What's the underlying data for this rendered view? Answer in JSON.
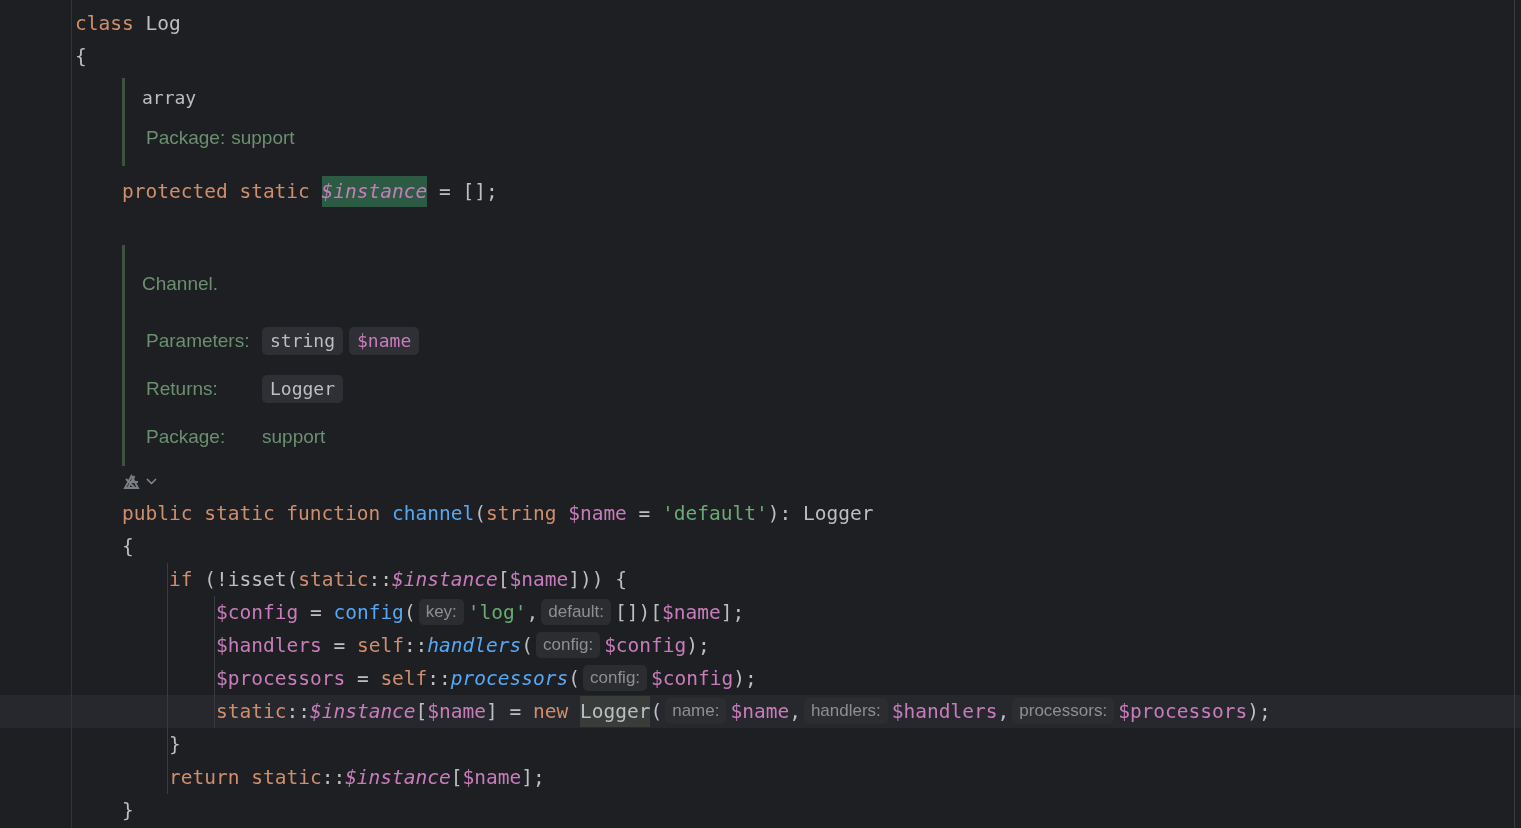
{
  "lines": [
    {
      "kind": "code",
      "current": false,
      "tokens": [
        {
          "text": "class ",
          "kind": "keyword"
        },
        {
          "text": "Log",
          "kind": "ident"
        }
      ]
    },
    {
      "kind": "code",
      "current": false,
      "tokens": [
        {
          "text": "{",
          "kind": "ident"
        }
      ],
      "children": [
        {
          "kind": "typedoc",
          "signature": "array",
          "fields": [
            {
              "label": "Package:",
              "values": [
                {
                  "text": "support",
                  "kind": "plain"
                }
              ]
            }
          ]
        },
        {
          "kind": "code",
          "current": false,
          "tokens": [
            {
              "text": "protected static ",
              "kind": "keyword"
            },
            {
              "text": "$instance",
              "kind": "static-field",
              "highlighted": true
            },
            {
              "text": " = [];",
              "kind": "ident"
            }
          ]
        },
        {
          "kind": "blank"
        },
        {
          "kind": "doc",
          "summary": "Channel.",
          "fields": [
            {
              "label": "Parameters:",
              "values": [
                {
                  "text": "string",
                  "kind": "type"
                },
                {
                  "text": "$name",
                  "kind": "var"
                }
              ]
            },
            {
              "label": "Returns:",
              "values": [
                {
                  "text": "Logger",
                  "kind": "type"
                }
              ]
            },
            {
              "label": "Package:",
              "values": [
                {
                  "text": "support",
                  "kind": "plain"
                }
              ]
            }
          ]
        },
        {
          "kind": "inlay-icons"
        },
        {
          "kind": "code",
          "current": false,
          "tokens": [
            {
              "text": "public static function ",
              "kind": "keyword"
            },
            {
              "text": "channel",
              "kind": "func"
            },
            {
              "text": "(",
              "kind": "ident"
            },
            {
              "text": "string ",
              "kind": "keyword"
            },
            {
              "text": "$name",
              "kind": "var"
            },
            {
              "text": " = ",
              "kind": "ident"
            },
            {
              "text": "'default'",
              "kind": "string"
            },
            {
              "text": "): Logger",
              "kind": "ident"
            }
          ]
        },
        {
          "kind": "code",
          "current": false,
          "tokens": [
            {
              "text": "{",
              "kind": "ident"
            }
          ],
          "children": [
            {
              "kind": "code",
              "current": false,
              "tokens": [
                {
                  "text": "if ",
                  "kind": "keyword"
                },
                {
                  "text": "(!isset(",
                  "kind": "ident"
                },
                {
                  "text": "static",
                  "kind": "keyword"
                },
                {
                  "text": "::",
                  "kind": "ident"
                },
                {
                  "text": "$instance",
                  "kind": "static-field"
                },
                {
                  "text": "[",
                  "kind": "ident"
                },
                {
                  "text": "$name",
                  "kind": "var"
                },
                {
                  "text": "])) {",
                  "kind": "ident"
                }
              ],
              "children": [
                {
                  "kind": "code",
                  "current": false,
                  "tokens": [
                    {
                      "text": "$config",
                      "kind": "var"
                    },
                    {
                      "text": " = ",
                      "kind": "ident"
                    },
                    {
                      "text": "config",
                      "kind": "func"
                    },
                    {
                      "text": "(",
                      "kind": "ident"
                    },
                    {
                      "text": "key:",
                      "kind": "hint"
                    },
                    {
                      "text": "'log'",
                      "kind": "string"
                    },
                    {
                      "text": ",",
                      "kind": "ident"
                    },
                    {
                      "text": "default:",
                      "kind": "hint"
                    },
                    {
                      "text": "[])[",
                      "kind": "ident"
                    },
                    {
                      "text": "$name",
                      "kind": "var"
                    },
                    {
                      "text": "];",
                      "kind": "ident"
                    }
                  ]
                },
                {
                  "kind": "code",
                  "current": false,
                  "tokens": [
                    {
                      "text": "$handlers",
                      "kind": "var"
                    },
                    {
                      "text": " = ",
                      "kind": "ident"
                    },
                    {
                      "text": "self",
                      "kind": "keyword"
                    },
                    {
                      "text": "::",
                      "kind": "ident"
                    },
                    {
                      "text": "handlers",
                      "kind": "static-func"
                    },
                    {
                      "text": "(",
                      "kind": "ident"
                    },
                    {
                      "text": "config:",
                      "kind": "hint"
                    },
                    {
                      "text": "$config",
                      "kind": "var"
                    },
                    {
                      "text": ");",
                      "kind": "ident"
                    }
                  ]
                },
                {
                  "kind": "code",
                  "current": false,
                  "tokens": [
                    {
                      "text": "$processors",
                      "kind": "var"
                    },
                    {
                      "text": " = ",
                      "kind": "ident"
                    },
                    {
                      "text": "self",
                      "kind": "keyword"
                    },
                    {
                      "text": "::",
                      "kind": "ident"
                    },
                    {
                      "text": "processors",
                      "kind": "static-func"
                    },
                    {
                      "text": "(",
                      "kind": "ident"
                    },
                    {
                      "text": "config:",
                      "kind": "hint"
                    },
                    {
                      "text": "$config",
                      "kind": "var"
                    },
                    {
                      "text": ");",
                      "kind": "ident"
                    }
                  ]
                },
                {
                  "kind": "code",
                  "current": true,
                  "tokens": [
                    {
                      "text": "static",
                      "kind": "keyword"
                    },
                    {
                      "text": "::",
                      "kind": "ident"
                    },
                    {
                      "text": "$instance",
                      "kind": "static-field"
                    },
                    {
                      "text": "[",
                      "kind": "ident"
                    },
                    {
                      "text": "$name",
                      "kind": "var"
                    },
                    {
                      "text": "] = ",
                      "kind": "ident"
                    },
                    {
                      "text": "new ",
                      "kind": "keyword"
                    },
                    {
                      "text": "Logger",
                      "kind": "ident",
                      "highlighted": true
                    },
                    {
                      "text": "(",
                      "kind": "ident"
                    },
                    {
                      "text": "name:",
                      "kind": "hint"
                    },
                    {
                      "text": "$name",
                      "kind": "var"
                    },
                    {
                      "text": ",",
                      "kind": "ident"
                    },
                    {
                      "text": "handlers:",
                      "kind": "hint"
                    },
                    {
                      "text": "$handlers",
                      "kind": "var"
                    },
                    {
                      "text": ",",
                      "kind": "ident"
                    },
                    {
                      "text": "processors:",
                      "kind": "hint"
                    },
                    {
                      "text": "$processors",
                      "kind": "var"
                    },
                    {
                      "text": ");",
                      "kind": "ident"
                    }
                  ]
                }
              ]
            },
            {
              "kind": "code",
              "current": false,
              "tokens": [
                {
                  "text": "}",
                  "kind": "ident"
                }
              ]
            },
            {
              "kind": "code",
              "current": false,
              "tokens": [
                {
                  "text": "return ",
                  "kind": "keyword"
                },
                {
                  "text": "static",
                  "kind": "keyword"
                },
                {
                  "text": "::",
                  "kind": "ident"
                },
                {
                  "text": "$instance",
                  "kind": "static-field"
                },
                {
                  "text": "[",
                  "kind": "ident"
                },
                {
                  "text": "$name",
                  "kind": "var"
                },
                {
                  "text": "];",
                  "kind": "ident"
                }
              ]
            }
          ]
        },
        {
          "kind": "code",
          "current": false,
          "tokens": [
            {
              "text": "}",
              "kind": "ident"
            }
          ]
        }
      ]
    }
  ]
}
